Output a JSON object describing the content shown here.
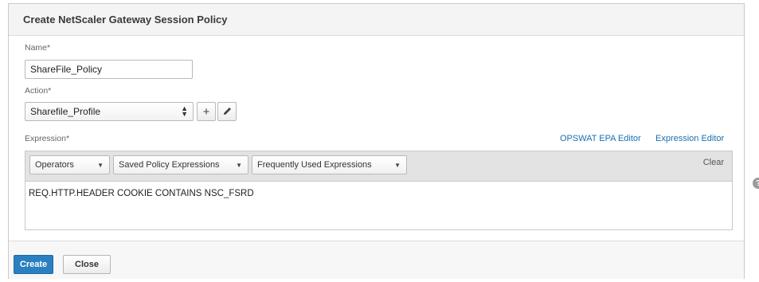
{
  "dialog": {
    "title": "Create NetScaler Gateway Session Policy"
  },
  "name_field": {
    "label": "Name*",
    "value": "ShareFile_Policy"
  },
  "action_field": {
    "label": "Action*",
    "selected": "Sharefile_Profile",
    "add_icon": "+",
    "edit_icon": "pencil-icon"
  },
  "expression": {
    "label": "Expression*",
    "links": {
      "opswat": "OPSWAT EPA Editor",
      "editor": "Expression Editor"
    },
    "toolbar": {
      "operators": "Operators",
      "saved": "Saved Policy Expressions",
      "frequent": "Frequently Used Expressions",
      "clear": "Clear"
    },
    "value": "REQ.HTTP.HEADER COOKIE CONTAINS NSC_FSRD"
  },
  "help_icon": "?",
  "footer": {
    "create": "Create",
    "close": "Close"
  },
  "colors": {
    "primary_button": "#2a7fc0",
    "link": "#1a6fb0",
    "toolbar_bg": "#e3e3e3"
  }
}
